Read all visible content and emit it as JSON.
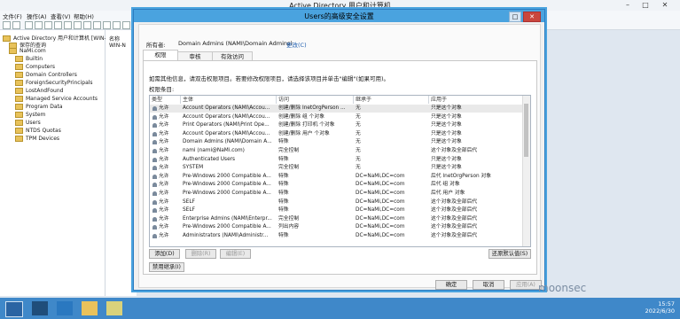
{
  "main_window": {
    "title": "Active Directory 用户和计算机",
    "menus": [
      "文件(F)",
      "操作(A)",
      "查看(V)",
      "帮助(H)"
    ]
  },
  "tree": {
    "root": "Active Directory 用户和计算机 [WIN-N",
    "saved": "保存的查询",
    "domain": "NaMi.com",
    "children": [
      "Builtin",
      "Computers",
      "Domain Controllers",
      "ForeignSecurityPrincipals",
      "LostAndFound",
      "Managed Service Accounts",
      "Program Data",
      "System",
      "Users",
      "NTDS Quotas",
      "TPM Devices"
    ]
  },
  "list_pane": {
    "col": "名称",
    "item": "WIN-N"
  },
  "dialog": {
    "title": "Users的高级安全设置",
    "owner_label": "所有者:",
    "owner_value": "Domain Admins (NAMI\\Domain Admins)",
    "owner_change": "更改(C)",
    "tabs": [
      "权限",
      "审核",
      "有效访问"
    ],
    "info": "如需其他信息，请双击权限项目。若要修改权限项目，请选择该项目并单击\"编辑\"(如果可用)。",
    "entries_label": "权限条目:",
    "headers": [
      "类型",
      "主体",
      "访问",
      "继承于",
      "应用于"
    ],
    "rows": [
      {
        "type": "允许",
        "principal": "Account Operators (NAMI\\Accou...",
        "access": "创建/删除 InetOrgPerson ...",
        "inherit": "无",
        "apply": "只是这个对象"
      },
      {
        "type": "允许",
        "principal": "Account Operators (NAMI\\Accou...",
        "access": "创建/删除 组 个对象",
        "inherit": "无",
        "apply": "只是这个对象"
      },
      {
        "type": "允许",
        "principal": "Print Operators (NAMI\\Print Ope...",
        "access": "创建/删除 打印机 个对象",
        "inherit": "无",
        "apply": "只是这个对象"
      },
      {
        "type": "允许",
        "principal": "Account Operators (NAMI\\Accou...",
        "access": "创建/删除 用户 个对象",
        "inherit": "无",
        "apply": "只是这个对象"
      },
      {
        "type": "允许",
        "principal": "Domain Admins (NAMI\\Domain A...",
        "access": "特殊",
        "inherit": "无",
        "apply": "只是这个对象"
      },
      {
        "type": "允许",
        "principal": "nami (nami@NaMi.com)",
        "access": "完全控制",
        "inherit": "无",
        "apply": "这个对象及全部后代"
      },
      {
        "type": "允许",
        "principal": "Authenticated Users",
        "access": "特殊",
        "inherit": "无",
        "apply": "只是这个对象"
      },
      {
        "type": "允许",
        "principal": "SYSTEM",
        "access": "完全控制",
        "inherit": "无",
        "apply": "只是这个对象"
      },
      {
        "type": "允许",
        "principal": "Pre-Windows 2000 Compatible A...",
        "access": "特殊",
        "inherit": "DC=NaMi,DC=com",
        "apply": "后代 InetOrgPerson 对象"
      },
      {
        "type": "允许",
        "principal": "Pre-Windows 2000 Compatible A...",
        "access": "特殊",
        "inherit": "DC=NaMi,DC=com",
        "apply": "后代 组 对象"
      },
      {
        "type": "允许",
        "principal": "Pre-Windows 2000 Compatible A...",
        "access": "特殊",
        "inherit": "DC=NaMi,DC=com",
        "apply": "后代 用户 对象"
      },
      {
        "type": "允许",
        "principal": "SELF",
        "access": "特殊",
        "inherit": "DC=NaMi,DC=com",
        "apply": "这个对象及全部后代"
      },
      {
        "type": "允许",
        "principal": "SELF",
        "access": "特殊",
        "inherit": "DC=NaMi,DC=com",
        "apply": "这个对象及全部后代"
      },
      {
        "type": "允许",
        "principal": "Enterprise Admins (NAMI\\Enterpr...",
        "access": "完全控制",
        "inherit": "DC=NaMi,DC=com",
        "apply": "这个对象及全部后代"
      },
      {
        "type": "允许",
        "principal": "Pre-Windows 2000 Compatible A...",
        "access": "列出内容",
        "inherit": "DC=NaMi,DC=com",
        "apply": "这个对象及全部后代"
      },
      {
        "type": "允许",
        "principal": "Administrators (NAMI\\Administr...",
        "access": "特殊",
        "inherit": "DC=NaMi,DC=com",
        "apply": "这个对象及全部后代"
      }
    ],
    "btn_add": "添加(D)",
    "btn_remove": "删除(R)",
    "btn_edit": "编辑(E)",
    "btn_restore": "还原默认值(S)",
    "btn_disable_inherit": "禁用继承(I)",
    "btn_ok": "确定",
    "btn_cancel": "取消",
    "btn_apply": "应用(A)"
  },
  "taskbar": {
    "time": "15:57",
    "date": "2022/6/30"
  },
  "watermark": "moonsec"
}
